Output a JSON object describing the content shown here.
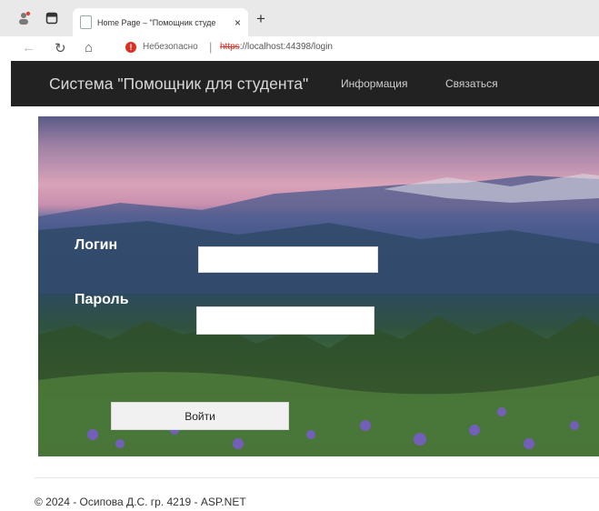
{
  "browser": {
    "tab_title": "Home Page – \"Помощник студе",
    "new_tab_symbol": "+",
    "close_symbol": "×",
    "not_secure_label": "Небезопасно",
    "separator": "|",
    "url_scheme": "https",
    "url_rest": "://localhost:44398/login"
  },
  "navbar": {
    "brand": "Система \"Помощник для студента\"",
    "links": [
      "Информация",
      "Связаться"
    ]
  },
  "login": {
    "login_label": "Логин",
    "password_label": "Пароль",
    "login_value": "",
    "password_value": "",
    "submit_label": "Войти"
  },
  "footer": {
    "text": "© 2024 - Осипова Д.С. гр. 4219 - ASP.NET"
  },
  "icons": {
    "back": "←",
    "reload": "↻",
    "home": "⌂",
    "warning": "!"
  },
  "colors": {
    "navbar_bg": "#222222",
    "insecure_red": "#d93025"
  }
}
